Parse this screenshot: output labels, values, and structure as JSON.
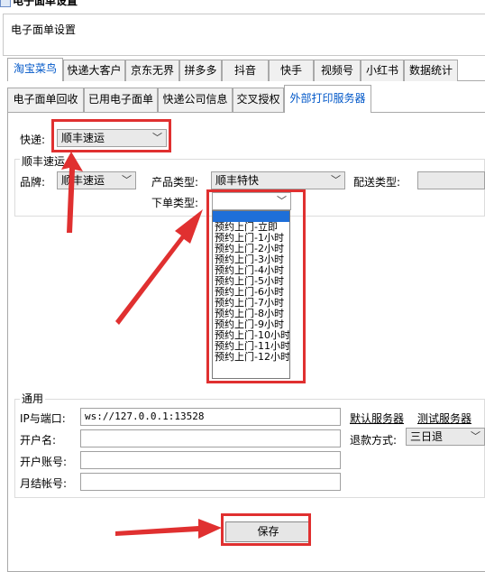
{
  "window": {
    "title": "电子面单设置"
  },
  "group": {
    "label": "电子面单设置"
  },
  "top_tabs": [
    "淘宝菜鸟",
    "快递大客户",
    "京东无界",
    "拼多多",
    "抖音",
    "快手",
    "视频号",
    "小红书",
    "数据统计"
  ],
  "sub_tabs": [
    "电子面单回收",
    "已用电子面单",
    "快递公司信息",
    "交叉授权",
    "外部打印服务器"
  ],
  "form": {
    "express_label": "快递:",
    "express_value": "顺丰速运",
    "section_label": "顺丰速运",
    "brand_label": "品牌:",
    "brand_value": "顺丰速运",
    "product_type_label": "产品类型:",
    "product_type_value": "顺丰特快",
    "delivery_type_label": "配送类型:",
    "delivery_type_value": "",
    "order_type_label": "下单类型:",
    "order_type_value": ""
  },
  "order_type_options": [
    "",
    "预约上门-立即",
    "预约上门-1小时",
    "预约上门-2小时",
    "预约上门-3小时",
    "预约上门-4小时",
    "预约上门-5小时",
    "预约上门-6小时",
    "预约上门-7小时",
    "预约上门-8小时",
    "预约上门-9小时",
    "预约上门-10小时",
    "预约上门-11小时",
    "预约上门-12小时"
  ],
  "general": {
    "legend": "通用",
    "ip_label": "IP与端口:",
    "ip_value": "ws://127.0.0.1:13528",
    "default_server_link": "默认服务器",
    "test_server_link": "测试服务器",
    "account_name_label": "开户名:",
    "account_name_value": "",
    "refund_label": "退款方式:",
    "refund_value": "三日退",
    "account_no_label": "开户账号:",
    "account_no_value": "",
    "monthly_no_label": "月结帐号:",
    "monthly_no_value": ""
  },
  "buttons": {
    "save": "保存"
  },
  "annotation_color": "#e03030"
}
